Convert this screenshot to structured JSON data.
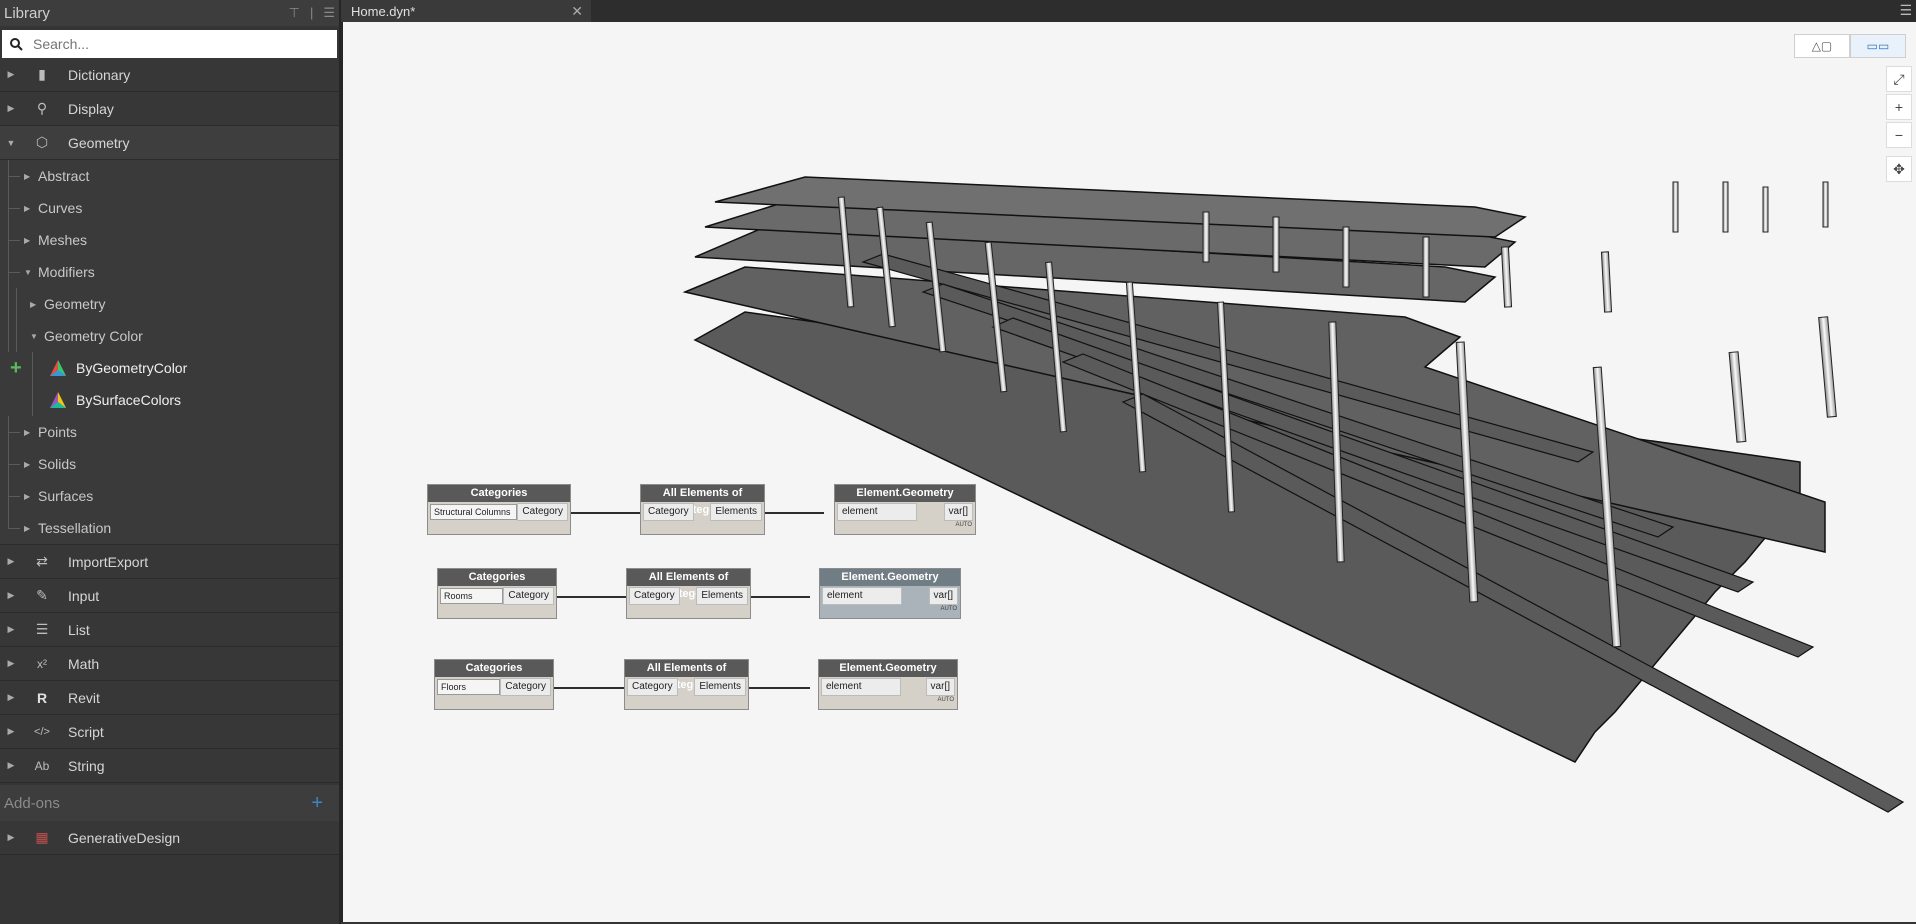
{
  "library": {
    "title": "Library",
    "search_placeholder": "Search...",
    "categories_top": [
      {
        "label": "Dictionary",
        "icon": "book-icon"
      },
      {
        "label": "Display",
        "icon": "magnifier-icon"
      },
      {
        "label": "Geometry",
        "icon": "cube-icon",
        "open": true
      }
    ],
    "geometry_children": [
      "Abstract",
      "Curves",
      "Meshes",
      "Modifiers"
    ],
    "modifiers_children": [
      "Geometry",
      "Geometry Color"
    ],
    "geometry_color_nodes": [
      "ByGeometryColor",
      "BySurfaceColors"
    ],
    "geometry_children_after": [
      "Points",
      "Solids",
      "Surfaces",
      "Tessellation"
    ],
    "categories_bottom": [
      {
        "label": "ImportExport",
        "icon": "arrows-icon"
      },
      {
        "label": "Input",
        "icon": "pencil-icon"
      },
      {
        "label": "List",
        "icon": "list-icon"
      },
      {
        "label": "Math",
        "icon": "math-icon",
        "glyph": "x²"
      },
      {
        "label": "Revit",
        "icon": "revit-icon",
        "glyph": "R"
      },
      {
        "label": "Script",
        "icon": "code-icon",
        "glyph": "</>"
      },
      {
        "label": "String",
        "icon": "string-icon",
        "glyph": "Ab"
      }
    ],
    "addons_title": "Add-ons",
    "addons": [
      {
        "label": "GenerativeDesign",
        "icon": "generative-design-icon"
      }
    ]
  },
  "workspace": {
    "tab_name": "Home.dyn*",
    "close_glyph": "✕",
    "view_toggle": [
      "3D view",
      "Graph view"
    ]
  },
  "nodes": {
    "row1": {
      "cat_title": "Categories",
      "cat_value": "Structural Columns",
      "cat_out": "Category",
      "all_title": "All Elements of Category",
      "all_in": "Category",
      "all_out": "Elements",
      "geo_title": "Element.Geometry",
      "geo_in": "element",
      "geo_out": "var[]",
      "lacing": "AUTO"
    },
    "row2": {
      "cat_title": "Categories",
      "cat_value": "Rooms",
      "cat_out": "Category",
      "all_title": "All Elements of Category",
      "all_in": "Category",
      "all_out": "Elements",
      "geo_title": "Element.Geometry",
      "geo_in": "element",
      "geo_out": "var[]",
      "lacing": "AUTO"
    },
    "row3": {
      "cat_title": "Categories",
      "cat_value": "Floors",
      "cat_out": "Category",
      "all_title": "All Elements of Category",
      "all_in": "Category",
      "all_out": "Elements",
      "geo_title": "Element.Geometry",
      "geo_in": "element",
      "geo_out": "var[]",
      "lacing": "AUTO"
    }
  },
  "colors": {
    "accent": "#3a86c8",
    "add_green": "#5cb85c",
    "node_header": "#595959",
    "background": "#f5f5f5"
  }
}
